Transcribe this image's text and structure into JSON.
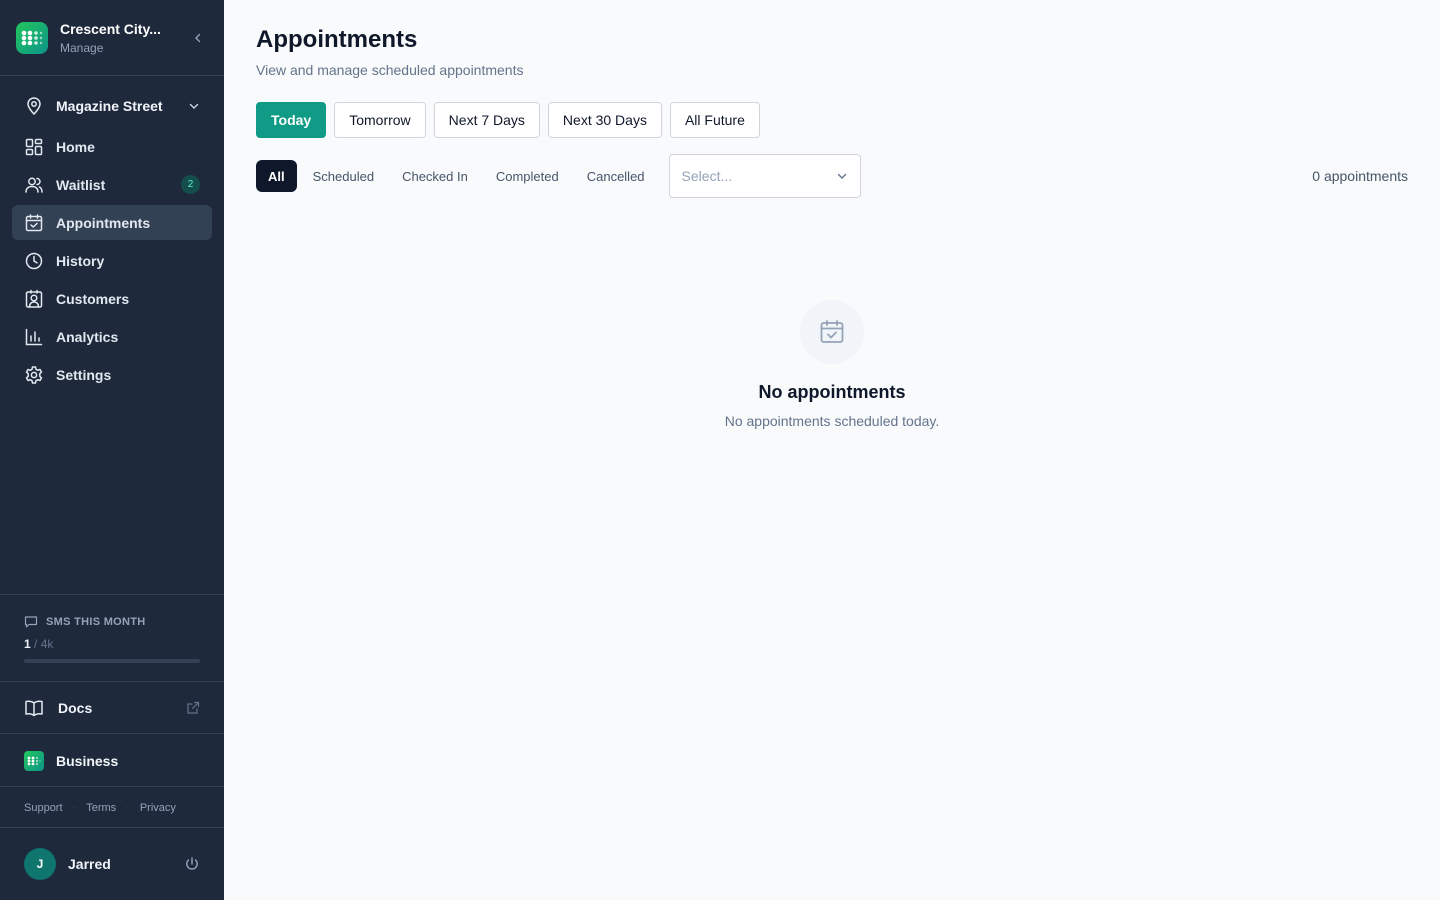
{
  "brand": {
    "name": "Crescent City...",
    "subtitle": "Manage"
  },
  "location": {
    "name": "Magazine Street"
  },
  "nav": [
    {
      "label": "Home",
      "icon": "grid-icon"
    },
    {
      "label": "Waitlist",
      "icon": "users-icon",
      "badge": "2"
    },
    {
      "label": "Appointments",
      "icon": "calendar-check-icon",
      "active": true
    },
    {
      "label": "History",
      "icon": "clock-icon"
    },
    {
      "label": "Customers",
      "icon": "contact-icon"
    },
    {
      "label": "Analytics",
      "icon": "bar-chart-icon"
    },
    {
      "label": "Settings",
      "icon": "gear-icon"
    }
  ],
  "sms": {
    "title": "SMS THIS MONTH",
    "used": "1",
    "limit": "/ 4k",
    "progress": 0.00025
  },
  "docs": {
    "label": "Docs"
  },
  "business": {
    "label": "Business"
  },
  "legal": {
    "support": "Support",
    "terms": "Terms",
    "privacy": "Privacy"
  },
  "user": {
    "initial": "J",
    "name": "Jarred"
  },
  "page": {
    "title": "Appointments",
    "subtitle": "View and manage scheduled appointments"
  },
  "ranges": [
    "Today",
    "Tomorrow",
    "Next 7 Days",
    "Next 30 Days",
    "All Future"
  ],
  "statuses": [
    "All",
    "Scheduled",
    "Checked In",
    "Completed",
    "Cancelled"
  ],
  "filter": {
    "placeholder": "Select..."
  },
  "count": "0 appointments",
  "empty": {
    "title": "No appointments",
    "subtitle": "No appointments scheduled today."
  },
  "colors": {
    "sidebar": "#1e293b",
    "accent": "#0f9b86",
    "active_tab": "#0f172a"
  }
}
